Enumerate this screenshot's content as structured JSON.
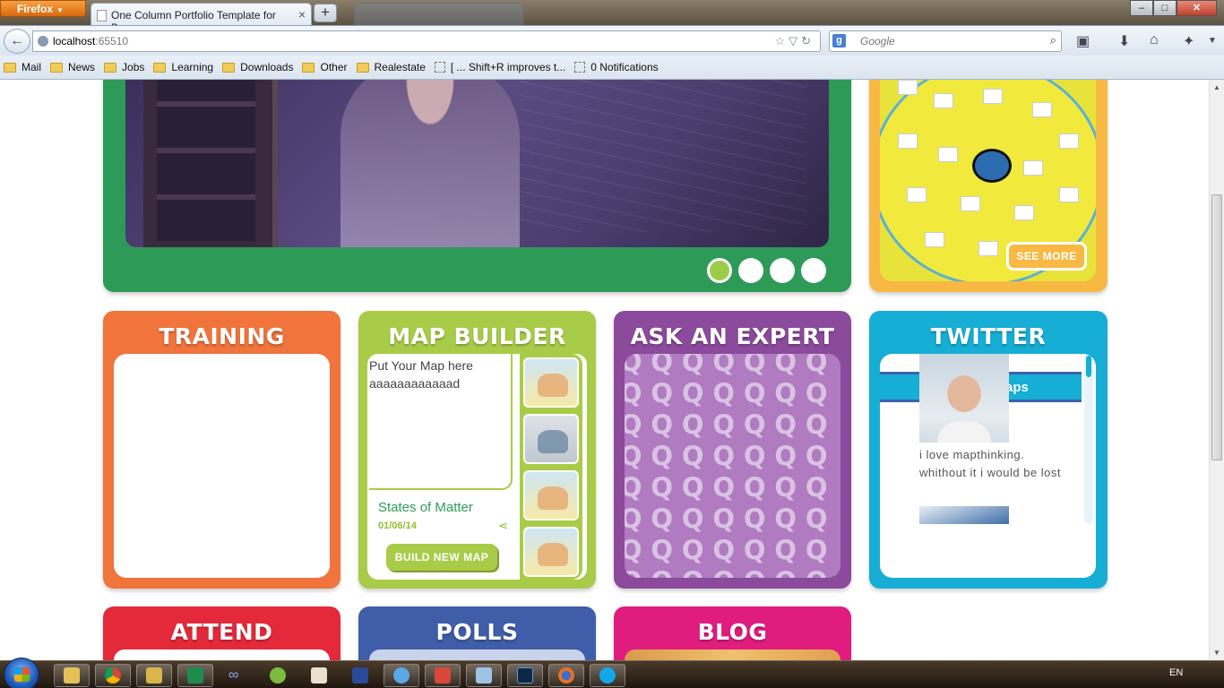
{
  "browser": {
    "app_button": "Firefox",
    "active_tab_title": "One Column Portfolio Template for Boo...",
    "url_host": "localhost",
    "url_port": ":65510",
    "search_placeholder": "Google",
    "search_engine_icon": "google-g-icon"
  },
  "bookmarks": [
    {
      "label": "Mail",
      "icon": "folder-icon"
    },
    {
      "label": "News",
      "icon": "folder-icon"
    },
    {
      "label": "Jobs",
      "icon": "folder-icon"
    },
    {
      "label": "Learning",
      "icon": "folder-icon"
    },
    {
      "label": "Downloads",
      "icon": "folder-icon"
    },
    {
      "label": "Other",
      "icon": "folder-icon"
    },
    {
      "label": "Realestate",
      "icon": "folder-icon"
    },
    {
      "label": "[ ... Shift+R improves t...",
      "icon": "page-icon"
    },
    {
      "label": "0 Notifications",
      "icon": "page-icon"
    }
  ],
  "hero": {
    "slides": 4,
    "active_slide": 1
  },
  "see_more": {
    "button_label": "SEE MORE"
  },
  "cards": {
    "training": {
      "title": "TRAINING",
      "color": "#f0743b"
    },
    "map_builder": {
      "title": "MAP BUILDER",
      "color": "#a8cc48",
      "placeholder_line1": "Put Your Map here",
      "placeholder_line2": "aaaaaaaaaaaad",
      "map_title": "States of Matter",
      "map_date": "01/06/14",
      "build_button": "BUILD NEW MAP",
      "thumbnails": 4
    },
    "ask_expert": {
      "title": "ASK AN EXPERT",
      "color": "#8c4a9c",
      "pattern_glyph": "Q"
    },
    "twitter": {
      "title": "TWITTER",
      "color": "#16aed5",
      "band_text": "aps",
      "tweet": "i love mapthinking. whithout it i would be lost"
    },
    "attend": {
      "title": "ATTEND",
      "color": "#e4293a"
    },
    "polls": {
      "title": "POLLS",
      "color": "#3f5da8"
    },
    "blog": {
      "title": "BLOG",
      "color": "#e01c7e"
    }
  },
  "taskbar": {
    "language": "EN",
    "apps": [
      "explorer",
      "chrome",
      "tool",
      "excel",
      "infinity",
      "browser-alt",
      "notes",
      "weather",
      "bubble",
      "gmail",
      "window",
      "photoshop",
      "firefox",
      "skype"
    ]
  }
}
